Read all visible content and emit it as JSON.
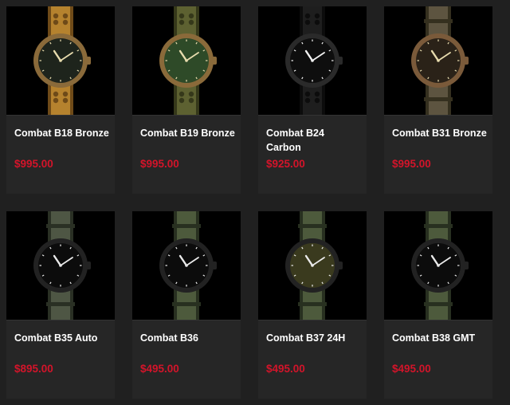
{
  "products": [
    {
      "name": "Combat B18 Bronze",
      "price": "$995.00",
      "strap": "#b5822e",
      "strap_dark": "#6e4a18",
      "case": "#8a6a3a",
      "dial": "#1e241c",
      "figure": "#e8dcae",
      "stitched": true
    },
    {
      "name": "Combat B19 Bronze",
      "price": "$995.00",
      "strap": "#5d6131",
      "strap_dark": "#35381a",
      "case": "#8a6a3a",
      "dial": "#2e4a28",
      "figure": "#e8dcae",
      "stitched": true
    },
    {
      "name": "Combat B24 Carbon",
      "price": "$925.00",
      "strap": "#1e1e1e",
      "strap_dark": "#0c0c0c",
      "case": "#2a2a2a",
      "dial": "#0e0e0e",
      "figure": "#f2f2f2",
      "stitched": true
    },
    {
      "name": "Combat B31 Bronze",
      "price": "$995.00",
      "strap": "#5d5440",
      "strap_dark": "#35301f",
      "case": "#7a5a3a",
      "dial": "#2a2218",
      "figure": "#e8dcae",
      "stitched": false
    },
    {
      "name": "Combat B35 Auto",
      "price": "$895.00",
      "strap": "#4e5644",
      "strap_dark": "#2a3024",
      "case": "#222222",
      "dial": "#0c0c0c",
      "figure": "#eaeaea",
      "stitched": false
    },
    {
      "name": "Combat B36",
      "price": "$495.00",
      "strap": "#4d5a3c",
      "strap_dark": "#283020",
      "case": "#222222",
      "dial": "#0c0c0c",
      "figure": "#eaeaea",
      "stitched": false
    },
    {
      "name": "Combat B37 24H",
      "price": "$495.00",
      "strap": "#4d5a3c",
      "strap_dark": "#283020",
      "case": "#222222",
      "dial": "#3a3a1e",
      "figure": "#eaeaea",
      "stitched": false
    },
    {
      "name": "Combat B38 GMT",
      "price": "$495.00",
      "strap": "#4d5a3c",
      "strap_dark": "#283020",
      "case": "#222222",
      "dial": "#0c0c0c",
      "figure": "#eaeaea",
      "stitched": false
    }
  ]
}
